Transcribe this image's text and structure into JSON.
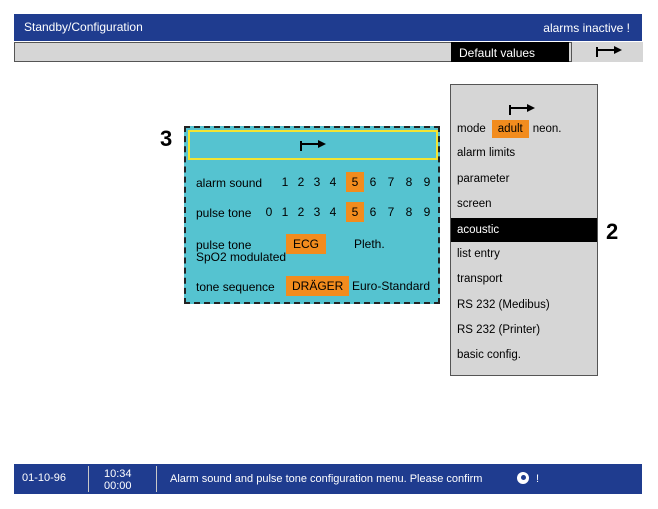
{
  "header": {
    "title": "Standby/Configuration",
    "status": "alarms inactive !",
    "default_values": "Default values"
  },
  "callouts": {
    "left": "3",
    "right": "2"
  },
  "acoustic_panel": {
    "alarm_sound": {
      "label": "alarm sound",
      "options": [
        "1",
        "2",
        "3",
        "4",
        "5",
        "6",
        "7",
        "8",
        "9"
      ],
      "selected": "5"
    },
    "pulse_tone": {
      "label": "pulse tone",
      "options": [
        "0",
        "1",
        "2",
        "3",
        "4",
        "5",
        "6",
        "7",
        "8",
        "9"
      ],
      "selected": "5"
    },
    "pulse_mod": {
      "label_1": "pulse tone",
      "label_2": "SpO2 modulated",
      "opt_selected": "ECG",
      "opt_other": "Pleth."
    },
    "tone_sequence": {
      "label": "tone sequence",
      "opt_selected": "DRÄGER",
      "opt_other": "Euro-Standard"
    }
  },
  "menu": {
    "mode_label": "mode",
    "mode_selected": "adult",
    "mode_other": "neon.",
    "items": [
      "alarm limits",
      "parameter",
      "screen",
      "acoustic",
      "list entry",
      "transport",
      "RS 232 (Medibus)",
      "RS 232 (Printer)",
      "basic config."
    ],
    "active": "acoustic"
  },
  "footer": {
    "date": "01-10-96",
    "time_1": "10:34",
    "time_2": "00:00",
    "message": "Alarm sound and pulse tone configuration menu. Please confirm",
    "exclamation": "!"
  }
}
